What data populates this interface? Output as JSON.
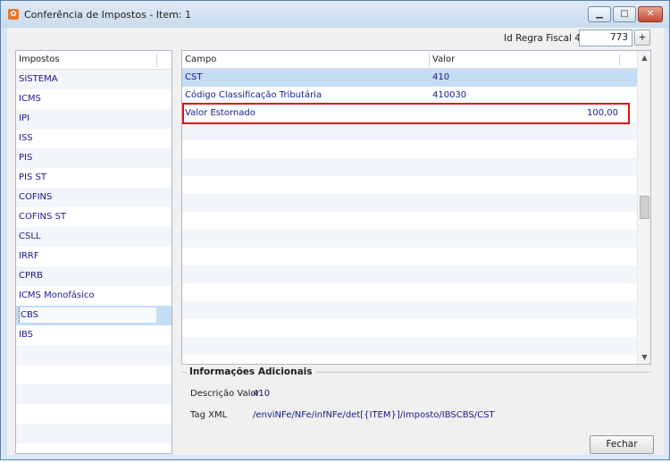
{
  "window": {
    "title": "Conferência de Impostos - Item: 1",
    "minimize": "▁",
    "maximize": "□",
    "close": "✕"
  },
  "regra": {
    "label": "Id Regra Fiscal 4.0",
    "value": "773",
    "add_label": "+"
  },
  "impostos": {
    "header": "Impostos",
    "items": [
      "SISTEMA",
      "ICMS",
      "IPI",
      "ISS",
      "PIS",
      "PIS ST",
      "COFINS",
      "COFINS ST",
      "CSLL",
      "IRRF",
      "CPRB",
      "ICMS Monofásico",
      "CBS",
      "IBS"
    ],
    "selected": "CBS"
  },
  "grid": {
    "col_campo": "Campo",
    "col_valor": "Valor",
    "rows": [
      {
        "campo": "CST",
        "valor": "410"
      },
      {
        "campo": "Código Classificação Tributária",
        "valor": "410030"
      },
      {
        "campo": "Valor Estornado",
        "valor": "100,00"
      }
    ]
  },
  "info": {
    "title": "Informações Adicionais",
    "descricao_label": "Descrição Valor",
    "descricao_value": "410",
    "tag_label": "Tag XML",
    "tag_value": "/enviNFe/NFe/infNFe/det[{ITEM}]/imposto/IBSCBS/CST"
  },
  "buttons": {
    "fechar": "Fechar"
  },
  "colors": {
    "highlight": "#e01010",
    "selection": "#c4ddf4",
    "text_blue": "#1a1a8a"
  }
}
